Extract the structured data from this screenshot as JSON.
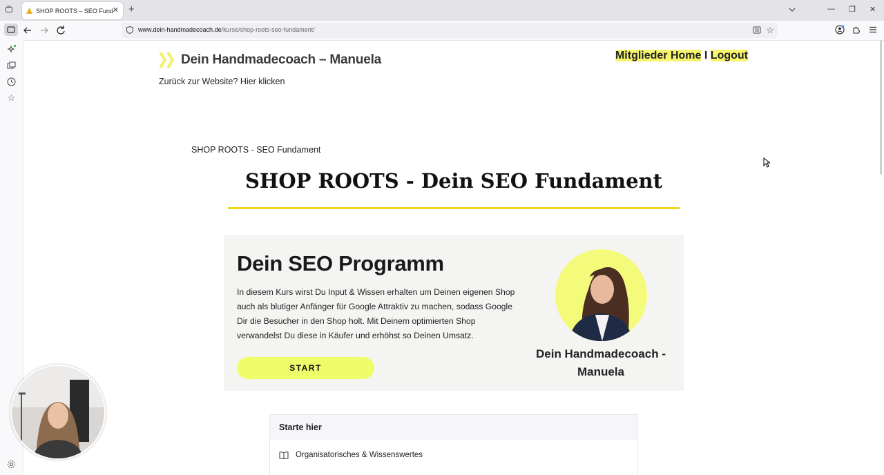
{
  "browser": {
    "tab_title": "SHOP ROOTS – SEO Fundament",
    "tab_close": "✕",
    "new_tab": "+",
    "url_domain": "www.dein-handmadecoach.de",
    "url_path": "/kurse/shop-roots-seo-fundament/",
    "window_controls": [
      "—",
      "❐",
      "✕"
    ]
  },
  "header": {
    "site_title": "Dein Handmadecoach – Manuela",
    "back_link": "Zurück zur Website? Hier klicken",
    "members_home": "Mitglieder Home",
    "separator": "I",
    "logout": "Logout",
    "accent_color": "#f7f56b"
  },
  "breadcrumb": "SHOP ROOTS - SEO Fundament",
  "page_title": "SHOP ROOTS - Dein SEO Fundament",
  "card": {
    "title": "Dein SEO Programm",
    "description": "In diesem Kurs wirst Du Input & Wissen erhalten um Deinen eigenen Shop auch als blutiger Anfänger für Google Attraktiv zu machen, sodass Google Dir die  Besucher in den Shop holt. Mit Deinem optimierten Shop verwandelst Du diese in Käufer und erhöhst so Deinen Umsatz.",
    "start_button": "START",
    "author_name": "Dein  Handmadecoach - Manuela"
  },
  "lessons": {
    "section_title": "Starte hier",
    "items": [
      "Organisatorisches & Wissenswertes"
    ]
  }
}
